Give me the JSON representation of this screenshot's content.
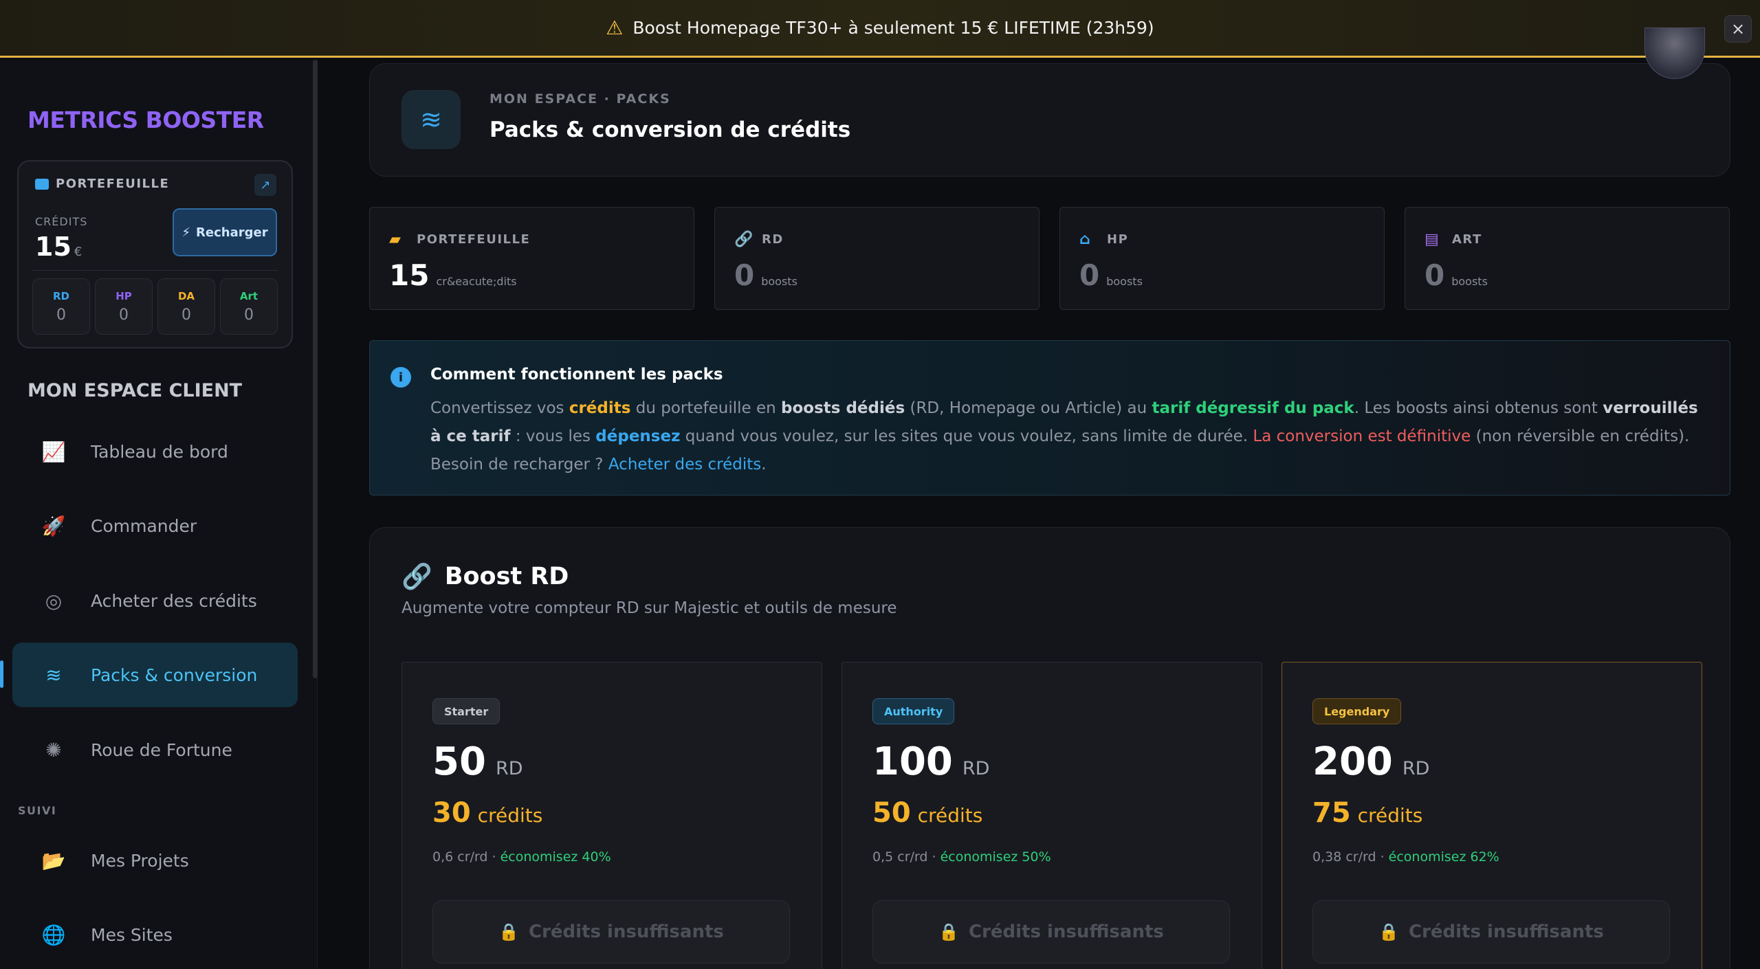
{
  "banner": {
    "icon": "warning-icon",
    "text": "Boost Homepage TF30+ à seulement 15 € LIFETIME (23h59)",
    "close": "×"
  },
  "sidebar": {
    "brand": "METRICS BOOSTER",
    "wallet": {
      "title": "PORTEFEUILLE",
      "credits_label": "CRÉDITS",
      "credits_value": "15",
      "currency": "€",
      "recharge_label": "Recharger",
      "stats": [
        {
          "label": "RD",
          "value": "0",
          "color": "#3aa7ef"
        },
        {
          "label": "HP",
          "value": "0",
          "color": "#8f63f5"
        },
        {
          "label": "DA",
          "value": "0",
          "color": "#f5b32a"
        },
        {
          "label": "Art",
          "value": "0",
          "color": "#2fd07a"
        }
      ]
    },
    "section_title": "MON ESPACE CLIENT",
    "nav": [
      {
        "label": "Tableau de bord",
        "icon": "chart-line-icon"
      },
      {
        "label": "Commander",
        "icon": "rocket-icon"
      },
      {
        "label": "Acheter des crédits",
        "icon": "coins-icon"
      },
      {
        "label": "Packs & conversion",
        "icon": "layers-icon",
        "active": true
      },
      {
        "label": "Roue de Fortune",
        "icon": "wheel-icon"
      }
    ],
    "suivi_label": "SUIVI",
    "nav2": [
      {
        "label": "Mes Projets",
        "icon": "folder-icon"
      },
      {
        "label": "Mes Sites",
        "icon": "globe-icon"
      }
    ]
  },
  "hero": {
    "crumb": "MON ESPACE · PACKS",
    "title": "Packs & conversion de crédits"
  },
  "stats": [
    {
      "label": "PORTEFEUILLE",
      "value": "15",
      "unit": "cr&eacute;dits",
      "icon": "wallet-icon",
      "color": "#f5b32a"
    },
    {
      "label": "RD",
      "value": "0",
      "unit": "boosts",
      "icon": "link-icon",
      "color": "#f5b32a"
    },
    {
      "label": "HP",
      "value": "0",
      "unit": "boosts",
      "icon": "home-icon",
      "color": "#3aa7ef"
    },
    {
      "label": "ART",
      "value": "0",
      "unit": "boosts",
      "icon": "newspaper-icon",
      "color": "#a970f0"
    }
  ],
  "info": {
    "title": "Comment fonctionnent les packs",
    "p1": "Convertissez vos ",
    "credits": "crédits",
    "p2": " du portefeuille en ",
    "boosts_dedies": "boosts dédiés",
    "p3": " (RD, Homepage ou Article) au ",
    "tarif": "tarif dégressif du pack",
    "p4": ". Les boosts ainsi obtenus sont ",
    "verrouilles": "verrouillés à ce tarif",
    "p5": " : vous les ",
    "depensez": "dépensez",
    "p6": " quand vous voulez, sur les sites que vous voulez, sans limite de durée. ",
    "conversion": "La conversion est définitive",
    "p7": " (non réversible en crédits). Besoin de recharger ? ",
    "link": "Acheter des crédits",
    "p8": "."
  },
  "boost_rd": {
    "title": "Boost RD",
    "subtitle": "Augmente votre compteur RD sur Majestic et outils de mesure",
    "packs": [
      {
        "badge": "Starter",
        "qty": "50",
        "unit": "RD",
        "price": "30",
        "price_unit": "crédits",
        "rate": "0,6 cr/rd · ",
        "saving": "économisez 40%",
        "button": "Crédits insuffisants"
      },
      {
        "badge": "Authority",
        "qty": "100",
        "unit": "RD",
        "price": "50",
        "price_unit": "crédits",
        "rate": "0,5 cr/rd · ",
        "saving": "économisez 50%",
        "button": "Crédits insuffisants"
      },
      {
        "badge": "Legendary",
        "qty": "200",
        "unit": "RD",
        "price": "75",
        "price_unit": "crédits",
        "rate": "0,38 cr/rd · ",
        "saving": "économisez 62%",
        "button": "Crédits insuffisants"
      }
    ]
  }
}
